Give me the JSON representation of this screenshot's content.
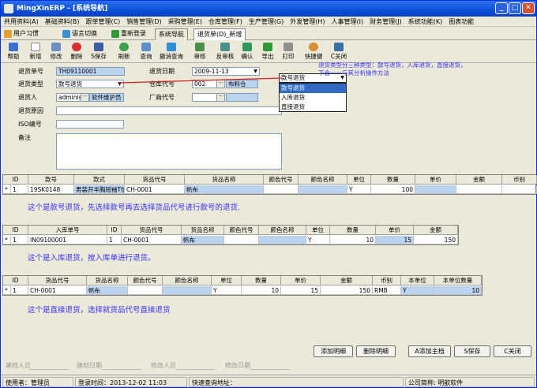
{
  "title": "MingXinERP - [系统导航]",
  "menus": [
    "共用资料(A)",
    "基础资料(B)",
    "跟单管理(C)",
    "销售管理(D)",
    "采购管理(E)",
    "仓库管理(F)",
    "生产管理(G)",
    "外发管理(H)",
    "人事管理(I)",
    "财务管理(J)",
    "系统功能(K)",
    "图表功能"
  ],
  "quick_tabs": [
    "用户习惯",
    "语言切换",
    "重新登录"
  ],
  "doc_tabs": [
    "系统导航",
    "退货单(D)_新增"
  ],
  "toolbar": [
    "帮助",
    "新增",
    "修改",
    "删除",
    "S保存",
    "刷新",
    "查询",
    "撤消查询",
    "审核",
    "反审核",
    "确认",
    "导出",
    "打印",
    "快捷键",
    "C关闭"
  ],
  "form": {
    "return_no_label": "退货单号",
    "return_no": "TH09110001",
    "return_date_label": "退货日期",
    "return_date": "2009-11-13",
    "return_type_label": "退货类型",
    "return_type": "款号退货",
    "warehouse_label": "仓库代号",
    "warehouse_code": "002",
    "warehouse_name": "布料仓",
    "returner_label": "退货人",
    "returner": "administ",
    "returner_btn": "软件维护员",
    "vendor_label": "厂商代号",
    "reason_label": "退货原因",
    "iso_label": "ISO编号",
    "remark_label": "备注",
    "type_select": "款号退货",
    "type_options": [
      "款号退货",
      "入库退货",
      "直接退货"
    ]
  },
  "annotation_top": "退货类型分三种类型：款号退货，入库退货，直接退货，下会一一与其分析操作方法",
  "grid1": {
    "headers": [
      "ID",
      "款号",
      "款式",
      "货品代号",
      "货品名称",
      "颜色代号",
      "颜色名称",
      "单位",
      "数量",
      "单价",
      "金额",
      "币别"
    ],
    "row": {
      "mark": "*",
      "id": "1",
      "style_no": "19SK0148",
      "style": "男装开半胸短袖T恤",
      "code": "CH-0001",
      "name": "帆布",
      "unit": "Y",
      "qty": "100"
    }
  },
  "note1": "这个是款号退货，先选择款号再去选择货品代号进行款号的退货.",
  "grid2": {
    "headers": [
      "ID",
      "入库单号",
      "ID",
      "货品代号",
      "货品名称",
      "颜色代号",
      "颜色名称",
      "单位",
      "数量",
      "单价",
      "金额"
    ],
    "row": {
      "mark": "*",
      "id": "1",
      "in_no": "IN09100001",
      "id2": "1",
      "code": "CH-0001",
      "name": "帆布",
      "unit": "Y",
      "qty": "10",
      "price": "15",
      "amount": "150"
    }
  },
  "note2": "这个是入库退货，按入库单进行退货。",
  "grid3": {
    "headers": [
      "ID",
      "货品代号",
      "货品名称",
      "颜色代号",
      "颜色名称",
      "单位",
      "数量",
      "单价",
      "金额",
      "币别",
      "本单位",
      "本单位数量"
    ],
    "row": {
      "mark": "*",
      "id": "1",
      "code": "CH-0001",
      "name": "帆布",
      "unit": "Y",
      "qty": "10",
      "price": "15",
      "amount": "150",
      "currency": "RMB",
      "base_unit": "Y",
      "base_qty": "10"
    }
  },
  "note3": "这个是直接退货，选择就货品代号直接退货",
  "buttons": [
    "添加明细",
    "删除明细",
    "A添加主档",
    "S保存",
    "C关闭"
  ],
  "footer": [
    "建档人员",
    "建档日期",
    "修改人员",
    "修改日期"
  ],
  "status": {
    "user": "使用者：管理员",
    "login": "登录时间：2013-12-02 11:03",
    "quick": "快速查询地址：",
    "company": "公司简称: 明歆软件"
  },
  "colors": {
    "title_bar": "#0a4fd6",
    "selection": "#316ac5",
    "note_text": "#3030ff",
    "leader_line": "#d02020",
    "highlight_cell": "#bcd3f0"
  }
}
